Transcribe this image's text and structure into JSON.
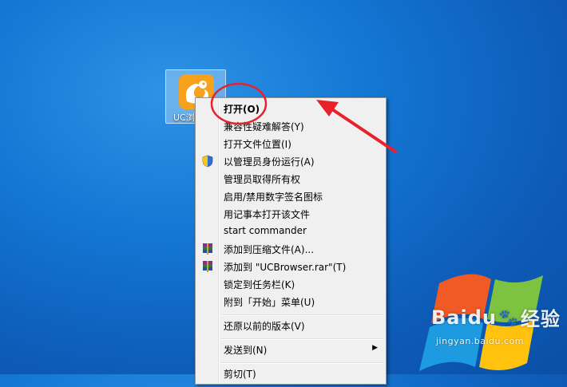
{
  "desktop": {
    "icon": {
      "label": "UC浏览器",
      "icon": "uc-browser-icon"
    },
    "watermark": {
      "brand": "Baidu",
      "paw": "🐾",
      "suffix": "经验",
      "url": "jingyan.baidu.com"
    }
  },
  "context_menu": {
    "items": [
      {
        "label": "打开(O)",
        "bold": true
      },
      {
        "label": "兼容性疑难解答(Y)"
      },
      {
        "label": "打开文件位置(I)"
      },
      {
        "label": "以管理员身份运行(A)",
        "icon": "uac-shield-icon"
      },
      {
        "label": "管理员取得所有权"
      },
      {
        "label": "启用/禁用数字签名图标"
      },
      {
        "label": "用记事本打开该文件"
      },
      {
        "label": "start commander"
      },
      {
        "label": "添加到压缩文件(A)...",
        "icon": "winrar-icon"
      },
      {
        "label": "添加到 \"UCBrowser.rar\"(T)",
        "icon": "winrar-icon"
      },
      {
        "label": "锁定到任务栏(K)"
      },
      {
        "label": "附到「开始」菜单(U)"
      },
      {
        "label": "还原以前的版本(V)"
      },
      {
        "label": "发送到(N)",
        "submenu": true
      },
      {
        "label": "剪切(T)"
      }
    ]
  },
  "annotation": {
    "circle_color": "#e8212b",
    "arrow_color": "#e8212b"
  }
}
